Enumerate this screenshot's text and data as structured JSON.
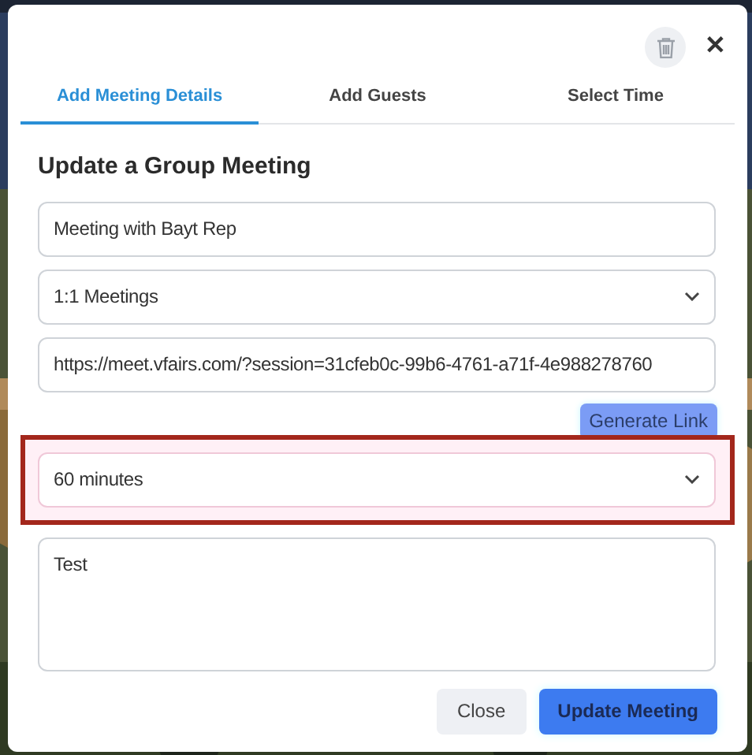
{
  "tabs": [
    {
      "label": "Add Meeting Details",
      "selected": true
    },
    {
      "label": "Add Guests",
      "selected": false
    },
    {
      "label": "Select Time",
      "selected": false
    }
  ],
  "header": {
    "close": "✕"
  },
  "title": "Update a Group Meeting",
  "fields": [
    {
      "kind": "text",
      "value": "Meeting with Bayt Rep"
    },
    {
      "kind": "select",
      "value": "1:1 Meetings"
    },
    {
      "kind": "text",
      "value": "https://meet.vfairs.com/?session=31cfeb0c-99b6-4761-a71f-4e988278760"
    },
    {
      "kind": "button",
      "value": "Generate Link"
    },
    {
      "kind": "select",
      "value": "60 minutes",
      "highlighted": true
    },
    {
      "kind": "textarea",
      "value": "Test"
    }
  ],
  "buttons": [
    {
      "label": "Close",
      "primary": false
    },
    {
      "label": "Update Meeting",
      "primary": true
    }
  ]
}
